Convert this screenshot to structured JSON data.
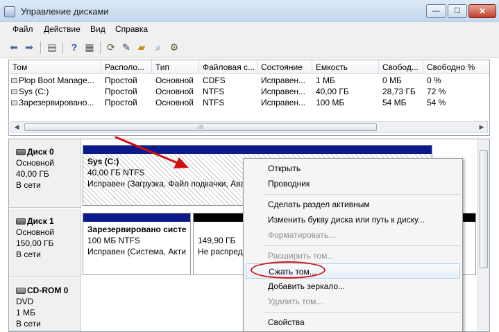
{
  "window": {
    "title": "Управление дисками",
    "btn_min": "—",
    "btn_max": "☐",
    "btn_close": "✕"
  },
  "menubar": {
    "items": [
      "Файл",
      "Действие",
      "Вид",
      "Справка"
    ]
  },
  "toolbar": {
    "icons": [
      "back-arrow-icon",
      "forward-arrow-icon",
      "console-tree-icon",
      "help-icon",
      "console-icon",
      "refresh-icon",
      "properties-icon",
      "folder-open-icon",
      "search-icon",
      "settings-icon"
    ]
  },
  "volumes": {
    "columns": [
      "Том",
      "Располо...",
      "Тип",
      "Файловая с...",
      "Состояние",
      "Емкость",
      "Свобод...",
      "Свободно %"
    ],
    "rows": [
      [
        "Plop Boot Manage...",
        "Простой",
        "Основной",
        "CDFS",
        "Исправен...",
        "1 МБ",
        "0 МБ",
        "0 %"
      ],
      [
        "Sys (C:)",
        "Простой",
        "Основной",
        "NTFS",
        "Исправен...",
        "40,00 ГБ",
        "28,73 ГБ",
        "72 %"
      ],
      [
        "Зарезервировано...",
        "Простой",
        "Основной",
        "NTFS",
        "Исправен...",
        "100 МБ",
        "54 МБ",
        "54 %"
      ]
    ],
    "scroll_grip": "III"
  },
  "disks": [
    {
      "name": "Диск 0",
      "type": "Основной",
      "size": "40,00 ГБ",
      "status": "В сети"
    },
    {
      "name": "Диск 1",
      "type": "Основной",
      "size": "150,00 ГБ",
      "status": "В сети"
    },
    {
      "name": "CD-ROM 0",
      "type": "DVD",
      "size": "1 МБ",
      "status": "В сети"
    }
  ],
  "partitions": {
    "sys": {
      "title": "Sys  (C:)",
      "line1": "40,00 ГБ NTFS",
      "line2": "Исправен (Загрузка, Файл подкачки, Ава"
    },
    "reserved": {
      "title": "Зарезервировано систе",
      "line1": "100 МБ NTFS",
      "line2": "Исправен (Система, Акти"
    },
    "unallocated": {
      "line1": "149,90 ГБ",
      "line2": "Не распреде"
    }
  },
  "context_menu": {
    "open": "Открыть",
    "explorer": "Проводник",
    "make_active": "Сделать раздел активным",
    "change_letter": "Изменить букву диска или путь к диску...",
    "format": "Форматировать...",
    "extend": "Расширить том...",
    "shrink": "Сжать том...",
    "add_mirror": "Добавить зеркало...",
    "delete": "Удалить том...",
    "properties": "Свойства"
  },
  "colors": {
    "primary_bar": "#0a1a8c",
    "unallocated_bar": "#000000",
    "annotation": "#d31010"
  }
}
